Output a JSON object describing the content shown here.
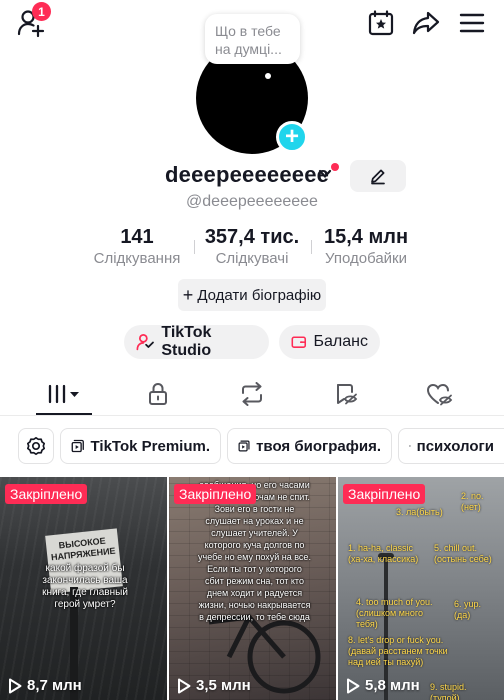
{
  "header": {
    "add_friend_badge": "1",
    "icons": [
      "add-friend-icon",
      "calendar-star-icon",
      "share-icon",
      "menu-icon"
    ]
  },
  "profile": {
    "thought_bubble": "Що в тебе на думці...",
    "username": "deeepeeeeeeee",
    "handle": "@deeepeeeeeeee",
    "stats": [
      {
        "value": "141",
        "label": "Слідкування"
      },
      {
        "value": "357,4 тис.",
        "label": "Слідкувачі"
      },
      {
        "value": "15,4 млн",
        "label": "Уподобайки"
      }
    ],
    "bio_button": "Додати біографію",
    "studio_button": "TikTok Studio",
    "balance_button": "Баланс"
  },
  "tabs": [
    "videos-grid",
    "private-lock",
    "reposts",
    "favorites",
    "liked"
  ],
  "playlists": [
    "TikTok Premium.",
    "твоя биография.",
    "психологи"
  ],
  "videos": [
    {
      "pinned": "Закріплено",
      "views": "8,7 млн",
      "caption": "какой фразой бы закончилась ваша книга, где главный герой умрет?",
      "sign": "ВЫСОКОЕ НАПРЯЖЕНИЕ"
    },
    {
      "pinned": "Закріплено",
      "views": "3,5 млн",
      "caption": "сообщения, но его часами игнорят. По ночам не спит. Зови его в гости не слушает на уроках и не слушает учителей. У которого куча долгов по учебе но ему похуй на все. Если ты тот у которого сбит режим сна, тот кто днем ходит и радуется жизни, ночью накрывается в депрессии, то тебе сюда"
    },
    {
      "pinned": "Закріплено",
      "views": "5,8 млн",
      "items": [
        "3. ла(быть)",
        "2. no. (нет)",
        "1. ha-ha, classic (ха-ха, классика)",
        "5. chill out. (остынь себе)",
        "4. too much of you. (слишком много тебя)",
        "6. yup. (да)",
        "8. let's drop or fuck you. (давай расстанем точки над ией ты пахуй)",
        "9. stupid. (тупой)"
      ]
    }
  ],
  "colors": {
    "accent": "#fe2c55",
    "plus": "#20d5ec",
    "muted": "#8a8b91",
    "chip_bg": "#f1f1f2"
  }
}
